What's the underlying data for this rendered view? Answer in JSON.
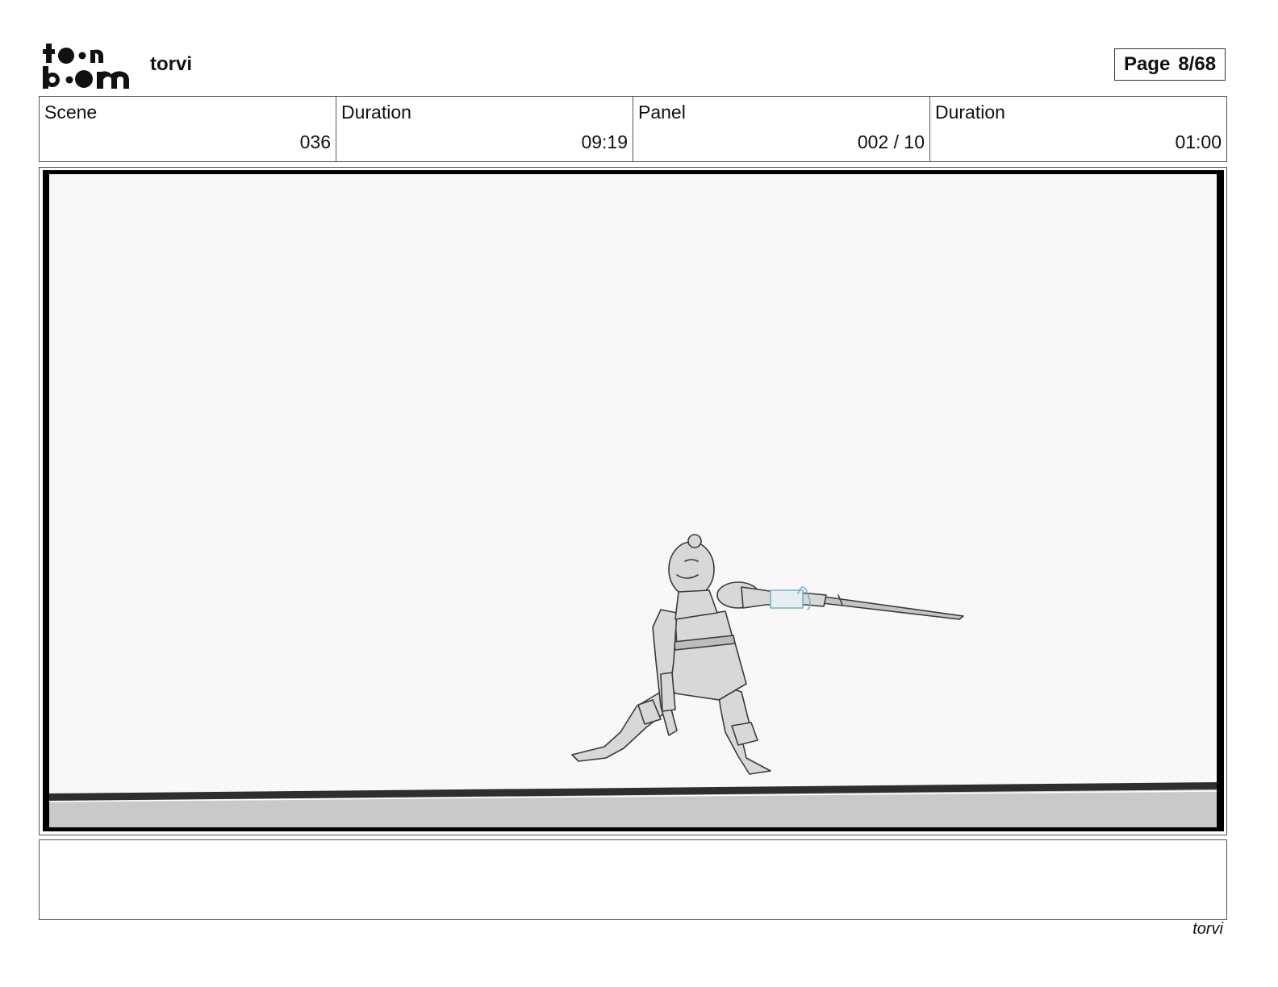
{
  "header": {
    "logo_text_top": "toon",
    "logo_text_bottom": "boom",
    "project_title": "torvi",
    "page_label": "Page",
    "page_number": "8/68"
  },
  "info": {
    "scene_label": "Scene",
    "scene_value": "036",
    "scene_duration_label": "Duration",
    "scene_duration_value": "09:19",
    "panel_label": "Panel",
    "panel_value": "002 / 10",
    "panel_duration_label": "Duration",
    "panel_duration_value": "01:00"
  },
  "panel": {
    "image": "storyboard sketch",
    "background_color": "#f8f8f8",
    "ground_color": "#c9c9c9",
    "ink_color": "#3a3a3a",
    "character_fill": "#d8d8d8",
    "accent_color": "#7ab0c4"
  },
  "notes": {
    "text": ""
  },
  "footer": {
    "project_title": "torvi"
  }
}
